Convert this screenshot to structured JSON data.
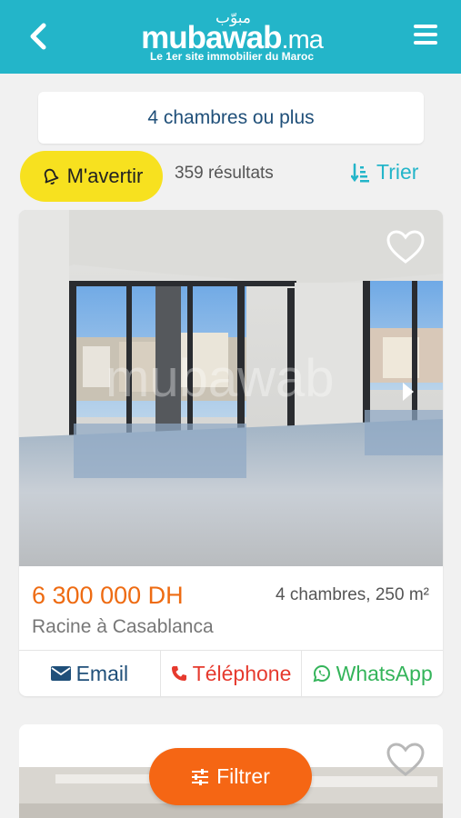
{
  "header": {
    "logo_arabic": "مبوّب",
    "logo_name": "mubawab",
    "logo_tld": ".ma",
    "tagline": "Le 1er site immobilier du Maroc"
  },
  "filters": {
    "active_filter": "4 chambres ou plus"
  },
  "toolbar": {
    "alert_label": "M'avertir",
    "results_count": "359 résultats",
    "sort_label": "Trier"
  },
  "listings": [
    {
      "price": "6 300 000 DH",
      "specs": "4 chambres, 250 m²",
      "location": "Racine à Casablanca",
      "watermark": "mubawab",
      "actions": {
        "email": "Email",
        "phone": "Téléphone",
        "whatsapp": "WhatsApp"
      }
    }
  ],
  "fab": {
    "filter_label": "Filtrer"
  },
  "colors": {
    "header": "#23b5c9",
    "alert": "#f7e11f",
    "price": "#ee6b12",
    "fab": "#f56614",
    "whatsapp": "#34b45a",
    "phone": "#e63a2e",
    "email": "#1f4f79"
  }
}
